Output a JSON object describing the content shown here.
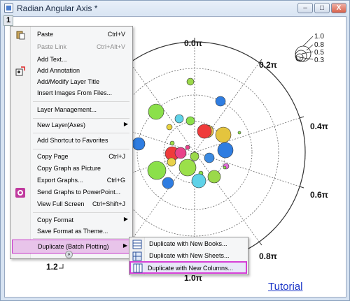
{
  "window": {
    "title": "Radian Angular Axis  *",
    "layer_tab": "1",
    "buttons": [
      "–",
      "□",
      "X"
    ]
  },
  "plot": {
    "angle_labels": [
      "0.0π",
      "0.2π",
      "0.4π",
      "0.6π",
      "0.8π",
      "1.0π",
      "1.2"
    ],
    "size_legend": [
      "1.0",
      "0.8",
      "0.5",
      "0.3"
    ]
  },
  "tutorial_link": "Tutorial",
  "context_menu": {
    "items": [
      {
        "label": "Paste",
        "shortcut": "Ctrl+V",
        "icon": "paste-icon"
      },
      {
        "label": "Paste Link",
        "shortcut": "Ctrl+Alt+V",
        "disabled": true
      },
      {
        "label": "Add Text..."
      },
      {
        "label": "Add Annotation",
        "icon": "annotation-icon"
      },
      {
        "label": "Add/Modify Layer Title"
      },
      {
        "label": "Insert Images From Files..."
      },
      {
        "label": "Layer Management..."
      },
      {
        "label": "New Layer(Axes)",
        "submenu": true
      },
      {
        "label": "Add Shortcut to Favorites"
      },
      {
        "label": "Copy Page",
        "shortcut": "Ctrl+J"
      },
      {
        "label": "Copy Graph as Picture"
      },
      {
        "label": "Export Graphs...",
        "shortcut": "Ctrl+G"
      },
      {
        "label": "Send Graphs to PowerPoint...",
        "icon": "powerpoint-icon"
      },
      {
        "label": "View Full Screen",
        "shortcut": "Ctrl+Shift+J"
      },
      {
        "label": "Copy Format",
        "submenu": true
      },
      {
        "label": "Save Format as Theme..."
      },
      {
        "label": "Duplicate (Batch Plotting)",
        "submenu": true
      }
    ]
  },
  "submenu": {
    "items": [
      {
        "label": "Duplicate with New Books..."
      },
      {
        "label": "Duplicate with New Sheets..."
      },
      {
        "label": "Duplicate with New Columns..."
      }
    ]
  }
}
